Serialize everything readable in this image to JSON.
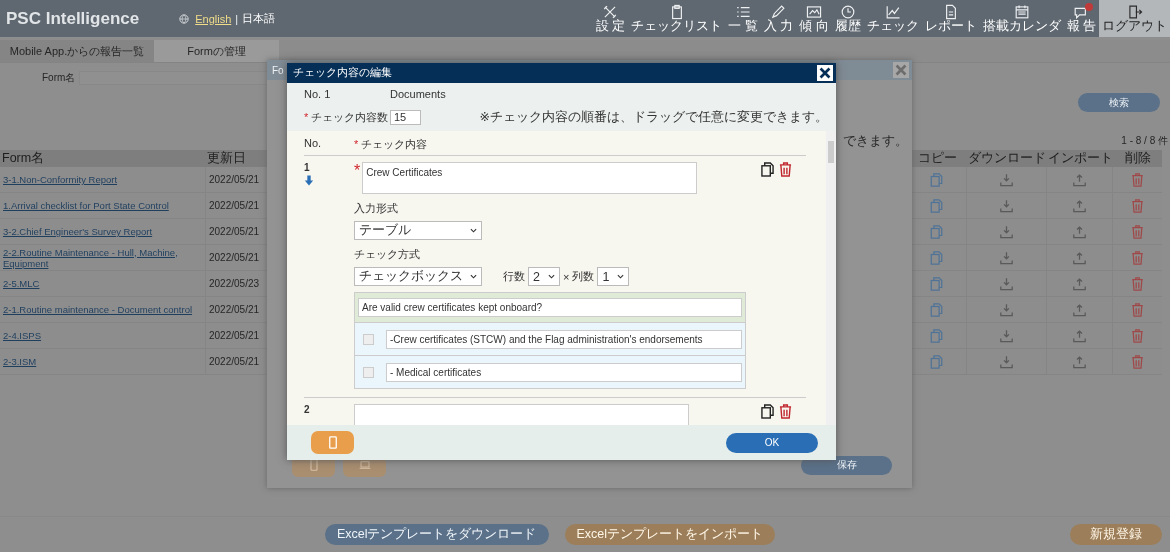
{
  "header": {
    "title": "PSC Intelligence",
    "languages": [
      {
        "label": "English",
        "selected": false
      },
      {
        "label": "日本語",
        "selected": true
      }
    ],
    "separator": "|",
    "nav": [
      {
        "label": "設 定",
        "alert": false,
        "selected": false
      },
      {
        "label": "チェックリスト",
        "alert": false,
        "selected": false
      },
      {
        "label": "一 覧",
        "alert": false,
        "selected": false
      },
      {
        "label": "入 力",
        "alert": false,
        "selected": false
      },
      {
        "label": "傾 向",
        "alert": false,
        "selected": false
      },
      {
        "label": "履歴",
        "alert": false,
        "selected": false
      },
      {
        "label": "チェック",
        "alert": false,
        "selected": false
      },
      {
        "label": "レポート",
        "alert": false,
        "selected": false
      },
      {
        "label": "搭載カレンダ",
        "alert": false,
        "selected": false
      },
      {
        "label": "報 告",
        "alert": true,
        "selected": false
      },
      {
        "label": "ログアウト",
        "alert": false,
        "selected": true
      }
    ]
  },
  "tabs": [
    {
      "label": "Mobile App.からの報告一覧",
      "selected": false
    },
    {
      "label": "Formの管理",
      "selected": true
    }
  ],
  "search": {
    "label": "Form名",
    "button": "検索"
  },
  "count": "1 - 8 / 8 件",
  "table": {
    "columns": [
      "Form名",
      "更新日",
      "コピー",
      "ダウンロード",
      "インポート",
      "削除"
    ],
    "rows": [
      {
        "name": "3-1.Non-Conformity Report",
        "updated": "2022/05/21"
      },
      {
        "name": "1.Arrival checklist for Port State Control",
        "updated": "2022/05/21"
      },
      {
        "name": "3-2.Chief Engineer's Survey Report",
        "updated": "2022/05/21"
      },
      {
        "name": "2-2.Routine Maintenance - Hull, Machine, Equipment",
        "updated": "2022/05/21"
      },
      {
        "name": "2-5.MLC",
        "updated": "2022/05/23"
      },
      {
        "name": "2-1.Routine maintenance - Document control",
        "updated": "2022/05/21"
      },
      {
        "name": "2-4.ISPS",
        "updated": "2022/05/21"
      },
      {
        "name": "2-3.ISM",
        "updated": "2022/05/21"
      }
    ]
  },
  "form_dialog": {
    "title": "Fo",
    "note": "できます。",
    "save": "保存"
  },
  "footer": {
    "buttons": [
      {
        "label": "Excelテンプレートをダウンロード",
        "kind": "primary"
      },
      {
        "label": "Excelテンプレートをインポート",
        "kind": "secondary"
      },
      {
        "label": "新規登録",
        "kind": "secondary"
      }
    ]
  },
  "editor": {
    "title": "チェック内容の編集",
    "no_label": "No. 1",
    "category": "Documents",
    "count_mark": "*",
    "count_label": "チェック内容数",
    "count": "15",
    "note": "※チェック内容の順番は、ドラッグで任意に変更できます。",
    "columns": [
      {
        "label": "No."
      },
      {
        "label": "チェック内容",
        "mark": "*"
      }
    ],
    "items": [
      {
        "number": "1",
        "content_mark": "*",
        "content": "Crew Certificates",
        "input_format_label": "入力形式",
        "input_format": "テーブル",
        "check_method_label": "チェック方式",
        "check_method": "チェックボックス",
        "rows_label": "行数",
        "rows": "2",
        "times": "×",
        "cols_label": "列数",
        "cols": "1",
        "question": "Are valid crew certificates kept onboard?",
        "options": [
          {
            "text": "-Crew certificates (STCW) and the Flag administration's endorsements",
            "checked": false
          },
          {
            "text": "- Medical certificates",
            "checked": false
          }
        ]
      },
      {
        "number": "2"
      }
    ],
    "ok": "OK"
  }
}
